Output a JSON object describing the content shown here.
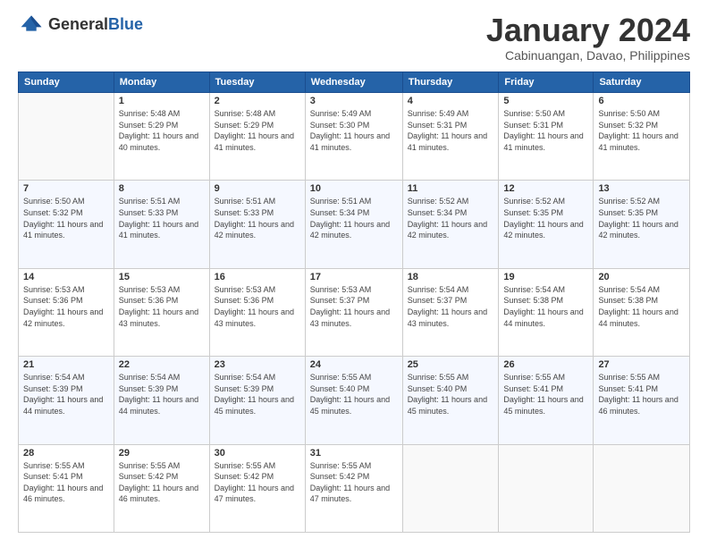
{
  "header": {
    "logo_general": "General",
    "logo_blue": "Blue",
    "month_title": "January 2024",
    "location": "Cabinuangan, Davao, Philippines"
  },
  "days_of_week": [
    "Sunday",
    "Monday",
    "Tuesday",
    "Wednesday",
    "Thursday",
    "Friday",
    "Saturday"
  ],
  "weeks": [
    [
      {
        "day": "",
        "sunrise": "",
        "sunset": "",
        "daylight": ""
      },
      {
        "day": "1",
        "sunrise": "Sunrise: 5:48 AM",
        "sunset": "Sunset: 5:29 PM",
        "daylight": "Daylight: 11 hours and 40 minutes."
      },
      {
        "day": "2",
        "sunrise": "Sunrise: 5:48 AM",
        "sunset": "Sunset: 5:29 PM",
        "daylight": "Daylight: 11 hours and 41 minutes."
      },
      {
        "day": "3",
        "sunrise": "Sunrise: 5:49 AM",
        "sunset": "Sunset: 5:30 PM",
        "daylight": "Daylight: 11 hours and 41 minutes."
      },
      {
        "day": "4",
        "sunrise": "Sunrise: 5:49 AM",
        "sunset": "Sunset: 5:31 PM",
        "daylight": "Daylight: 11 hours and 41 minutes."
      },
      {
        "day": "5",
        "sunrise": "Sunrise: 5:50 AM",
        "sunset": "Sunset: 5:31 PM",
        "daylight": "Daylight: 11 hours and 41 minutes."
      },
      {
        "day": "6",
        "sunrise": "Sunrise: 5:50 AM",
        "sunset": "Sunset: 5:32 PM",
        "daylight": "Daylight: 11 hours and 41 minutes."
      }
    ],
    [
      {
        "day": "7",
        "sunrise": "Sunrise: 5:50 AM",
        "sunset": "Sunset: 5:32 PM",
        "daylight": "Daylight: 11 hours and 41 minutes."
      },
      {
        "day": "8",
        "sunrise": "Sunrise: 5:51 AM",
        "sunset": "Sunset: 5:33 PM",
        "daylight": "Daylight: 11 hours and 41 minutes."
      },
      {
        "day": "9",
        "sunrise": "Sunrise: 5:51 AM",
        "sunset": "Sunset: 5:33 PM",
        "daylight": "Daylight: 11 hours and 42 minutes."
      },
      {
        "day": "10",
        "sunrise": "Sunrise: 5:51 AM",
        "sunset": "Sunset: 5:34 PM",
        "daylight": "Daylight: 11 hours and 42 minutes."
      },
      {
        "day": "11",
        "sunrise": "Sunrise: 5:52 AM",
        "sunset": "Sunset: 5:34 PM",
        "daylight": "Daylight: 11 hours and 42 minutes."
      },
      {
        "day": "12",
        "sunrise": "Sunrise: 5:52 AM",
        "sunset": "Sunset: 5:35 PM",
        "daylight": "Daylight: 11 hours and 42 minutes."
      },
      {
        "day": "13",
        "sunrise": "Sunrise: 5:52 AM",
        "sunset": "Sunset: 5:35 PM",
        "daylight": "Daylight: 11 hours and 42 minutes."
      }
    ],
    [
      {
        "day": "14",
        "sunrise": "Sunrise: 5:53 AM",
        "sunset": "Sunset: 5:36 PM",
        "daylight": "Daylight: 11 hours and 42 minutes."
      },
      {
        "day": "15",
        "sunrise": "Sunrise: 5:53 AM",
        "sunset": "Sunset: 5:36 PM",
        "daylight": "Daylight: 11 hours and 43 minutes."
      },
      {
        "day": "16",
        "sunrise": "Sunrise: 5:53 AM",
        "sunset": "Sunset: 5:36 PM",
        "daylight": "Daylight: 11 hours and 43 minutes."
      },
      {
        "day": "17",
        "sunrise": "Sunrise: 5:53 AM",
        "sunset": "Sunset: 5:37 PM",
        "daylight": "Daylight: 11 hours and 43 minutes."
      },
      {
        "day": "18",
        "sunrise": "Sunrise: 5:54 AM",
        "sunset": "Sunset: 5:37 PM",
        "daylight": "Daylight: 11 hours and 43 minutes."
      },
      {
        "day": "19",
        "sunrise": "Sunrise: 5:54 AM",
        "sunset": "Sunset: 5:38 PM",
        "daylight": "Daylight: 11 hours and 44 minutes."
      },
      {
        "day": "20",
        "sunrise": "Sunrise: 5:54 AM",
        "sunset": "Sunset: 5:38 PM",
        "daylight": "Daylight: 11 hours and 44 minutes."
      }
    ],
    [
      {
        "day": "21",
        "sunrise": "Sunrise: 5:54 AM",
        "sunset": "Sunset: 5:39 PM",
        "daylight": "Daylight: 11 hours and 44 minutes."
      },
      {
        "day": "22",
        "sunrise": "Sunrise: 5:54 AM",
        "sunset": "Sunset: 5:39 PM",
        "daylight": "Daylight: 11 hours and 44 minutes."
      },
      {
        "day": "23",
        "sunrise": "Sunrise: 5:54 AM",
        "sunset": "Sunset: 5:39 PM",
        "daylight": "Daylight: 11 hours and 45 minutes."
      },
      {
        "day": "24",
        "sunrise": "Sunrise: 5:55 AM",
        "sunset": "Sunset: 5:40 PM",
        "daylight": "Daylight: 11 hours and 45 minutes."
      },
      {
        "day": "25",
        "sunrise": "Sunrise: 5:55 AM",
        "sunset": "Sunset: 5:40 PM",
        "daylight": "Daylight: 11 hours and 45 minutes."
      },
      {
        "day": "26",
        "sunrise": "Sunrise: 5:55 AM",
        "sunset": "Sunset: 5:41 PM",
        "daylight": "Daylight: 11 hours and 45 minutes."
      },
      {
        "day": "27",
        "sunrise": "Sunrise: 5:55 AM",
        "sunset": "Sunset: 5:41 PM",
        "daylight": "Daylight: 11 hours and 46 minutes."
      }
    ],
    [
      {
        "day": "28",
        "sunrise": "Sunrise: 5:55 AM",
        "sunset": "Sunset: 5:41 PM",
        "daylight": "Daylight: 11 hours and 46 minutes."
      },
      {
        "day": "29",
        "sunrise": "Sunrise: 5:55 AM",
        "sunset": "Sunset: 5:42 PM",
        "daylight": "Daylight: 11 hours and 46 minutes."
      },
      {
        "day": "30",
        "sunrise": "Sunrise: 5:55 AM",
        "sunset": "Sunset: 5:42 PM",
        "daylight": "Daylight: 11 hours and 47 minutes."
      },
      {
        "day": "31",
        "sunrise": "Sunrise: 5:55 AM",
        "sunset": "Sunset: 5:42 PM",
        "daylight": "Daylight: 11 hours and 47 minutes."
      },
      {
        "day": "",
        "sunrise": "",
        "sunset": "",
        "daylight": ""
      },
      {
        "day": "",
        "sunrise": "",
        "sunset": "",
        "daylight": ""
      },
      {
        "day": "",
        "sunrise": "",
        "sunset": "",
        "daylight": ""
      }
    ]
  ]
}
